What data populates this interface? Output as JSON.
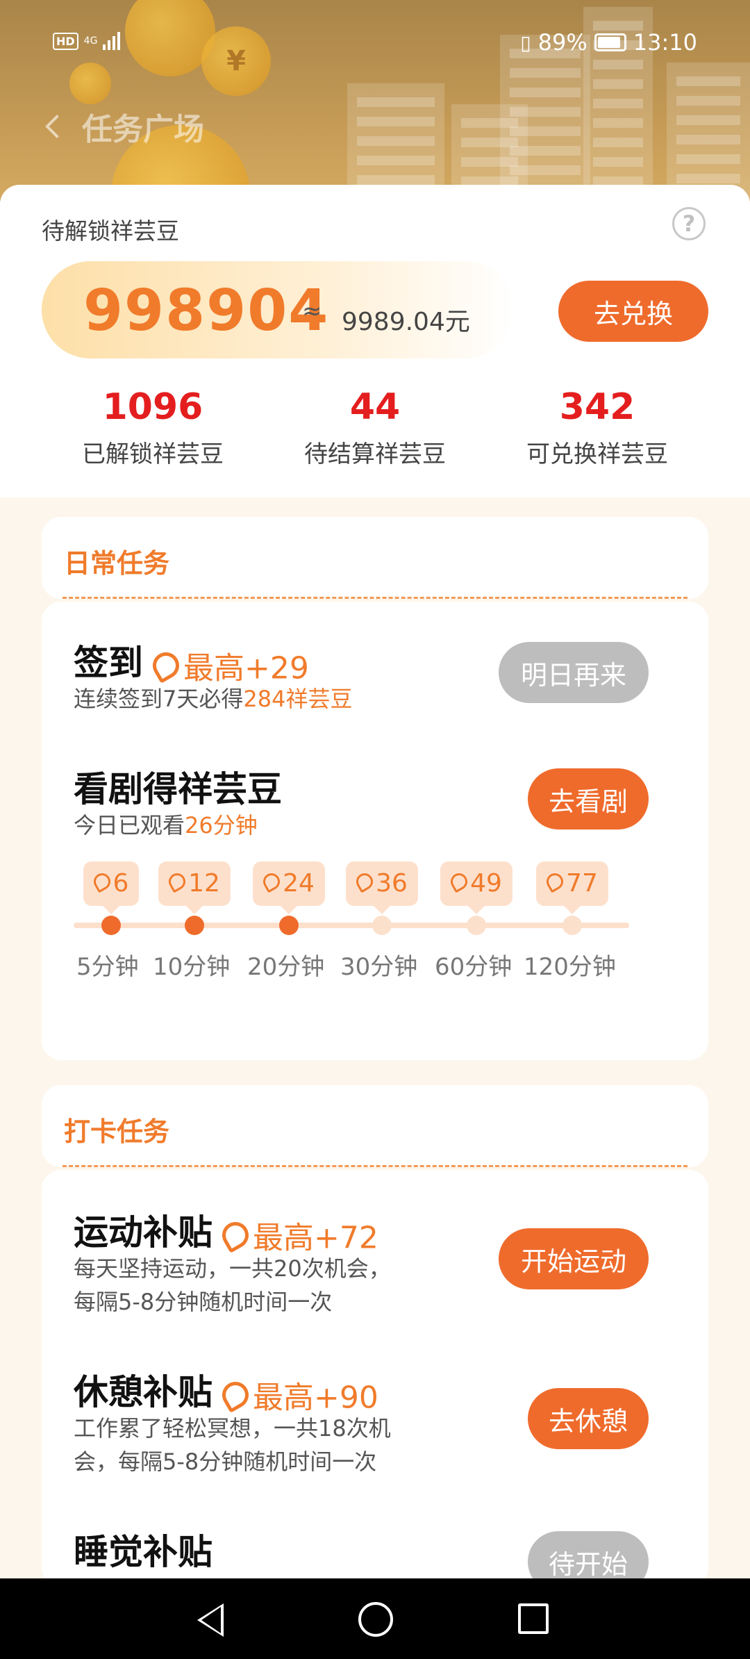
{
  "status_bar": {
    "left": "HD 4G",
    "battery": "89%",
    "time": "13:10"
  },
  "nav": {
    "title": "任务广场"
  },
  "summary": {
    "label": "待解锁祥芸豆",
    "help": "?",
    "locked_amount": "998904",
    "approx_symbol": "≈",
    "approx_value": "9989.04元",
    "exchange_button": "去兑换",
    "stats": [
      {
        "value": "1096",
        "label": "已解锁祥芸豆"
      },
      {
        "value": "44",
        "label": "待结算祥芸豆"
      },
      {
        "value": "342",
        "label": "可兑换祥芸豆"
      }
    ]
  },
  "daily": {
    "title": "日常任务",
    "signin": {
      "title": "签到",
      "reward": "最高+29",
      "desc_prefix": "连续签到7天必得",
      "desc_highlight": "284祥芸豆",
      "button": "明日再来"
    },
    "watch": {
      "title": "看剧得祥芸豆",
      "desc_prefix": "今日已观看",
      "desc_highlight": "26分钟",
      "button": "去看剧",
      "milestones": [
        {
          "reward": "6",
          "label": "5分钟",
          "done": true
        },
        {
          "reward": "12",
          "label": "10分钟",
          "done": true
        },
        {
          "reward": "24",
          "label": "20分钟",
          "done": true
        },
        {
          "reward": "36",
          "label": "30分钟",
          "done": false
        },
        {
          "reward": "49",
          "label": "60分钟",
          "done": false
        },
        {
          "reward": "77",
          "label": "120分钟",
          "done": false
        }
      ]
    }
  },
  "checkin": {
    "title": "打卡任务",
    "exercise": {
      "title": "运动补贴",
      "reward": "最高+72",
      "desc_line1": "每天坚持运动，一共20次机会，",
      "desc_line2": "每隔5-8分钟随机时间一次",
      "button": "开始运动"
    },
    "rest": {
      "title": "休憩补贴",
      "reward": "最高+90",
      "desc_line1": "工作累了轻松冥想，一共18次机",
      "desc_line2": "会，每隔5-8分钟随机时间一次",
      "button": "去休憩"
    },
    "sleep": {
      "title": "睡觉补贴",
      "button": "待开始"
    }
  },
  "colors": {
    "accent": "#ef6b2c",
    "number_red": "#e41e1e",
    "disabled": "#bdbdbd"
  }
}
